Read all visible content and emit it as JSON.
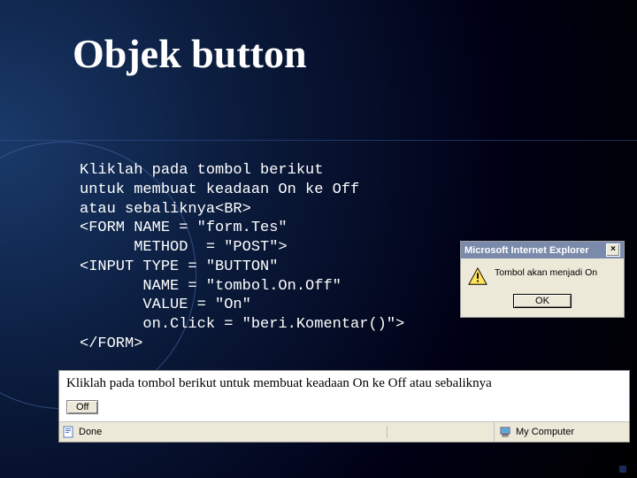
{
  "title": "Objek button",
  "code": "Kliklah pada tombol berikut\nuntuk membuat keadaan On ke Off\natau sebaliknya<BR>\n<FORM NAME = \"form.Tes\"\n      METHOD  = \"POST\">\n<INPUT TYPE = \"BUTTON\"\n       NAME = \"tombol.On.Off\"\n       VALUE = \"On\"\n       on.Click = \"beri.Komentar()\">\n</FORM>",
  "dialog": {
    "title": "Microsoft Internet Explorer",
    "message": "Tombol akan menjadi On",
    "ok": "OK"
  },
  "browser": {
    "text": "Kliklah pada tombol berikut untuk membuat keadaan On ke Off atau sebaliknya",
    "button": "Off",
    "status_done": "Done",
    "status_zone": "My Computer"
  }
}
